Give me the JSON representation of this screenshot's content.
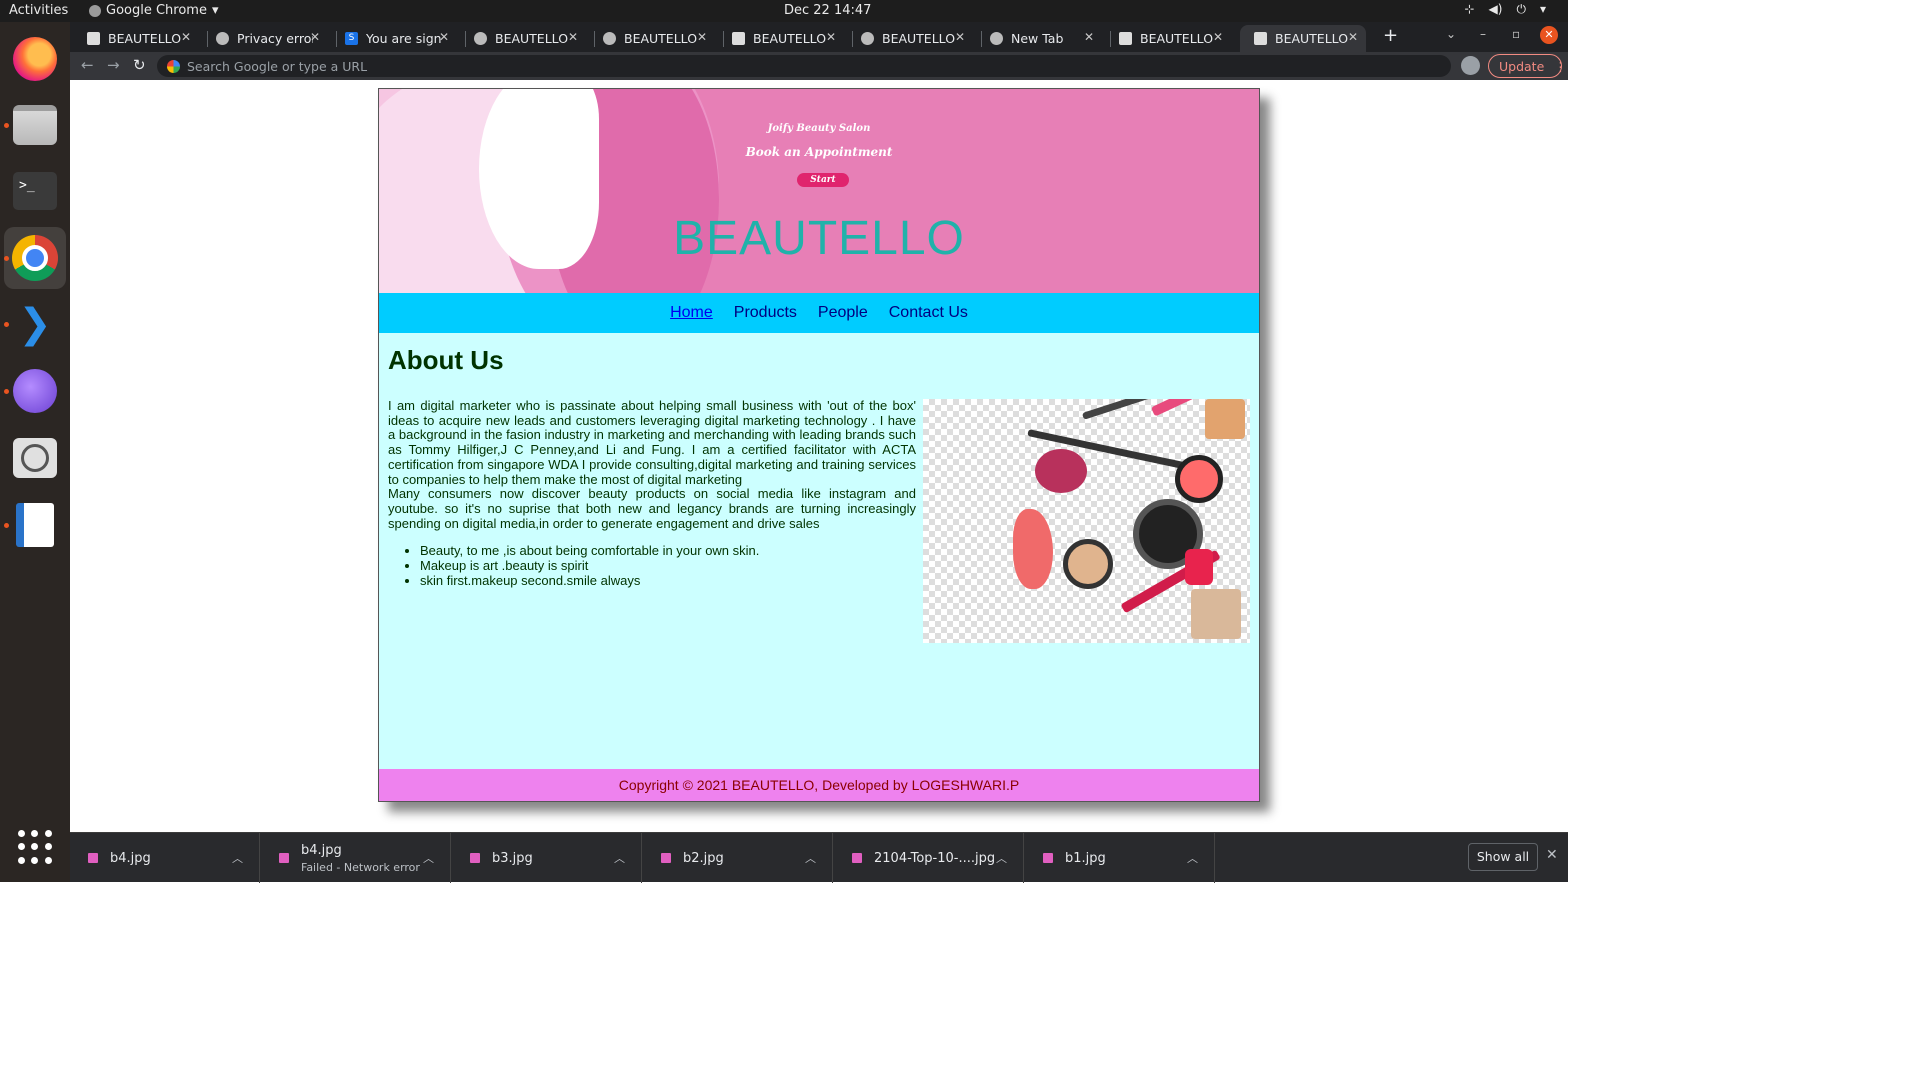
{
  "topbar": {
    "activities": "Activities",
    "app_name": "Google Chrome",
    "clock": "Dec 22  14:47"
  },
  "dock": {
    "items": [
      "firefox-icon",
      "files-icon",
      "terminal-icon",
      "chrome-icon",
      "vscode-icon",
      "browser-icon",
      "image-viewer-icon",
      "writer-icon"
    ]
  },
  "browser": {
    "tabs": [
      {
        "label": "BEAUTELLO"
      },
      {
        "label": "Privacy error"
      },
      {
        "label": "You are signed"
      },
      {
        "label": "BEAUTELLO"
      },
      {
        "label": "BEAUTELLO"
      },
      {
        "label": "BEAUTELLO"
      },
      {
        "label": "BEAUTELLO"
      },
      {
        "label": "New Tab"
      },
      {
        "label": "BEAUTELLO"
      },
      {
        "label": "BEAUTELLO"
      }
    ],
    "omnibox_placeholder": "Search Google or type a URL",
    "update_label": "Update"
  },
  "site": {
    "salon": "Joify Beauty Salon",
    "book": "Book an Appointment",
    "start": "Start",
    "brand": "BEAUTELLO",
    "nav": [
      "Home",
      "Products",
      "People",
      "Contact Us"
    ],
    "heading": "About Us",
    "para1": "I am digital marketer who is passinate about helping small business with 'out of the box' ideas to acquire new leads and customers leveraging digital marketing technology . I have a background in the fasion industry in marketing and merchanding with leading brands such as Tommy Hilfiger,J C Penney,and Li and Fung. I am a certified facilitator with ACTA certification from singapore WDA I provide consulting,digital marketing and training services to companies to help them make the most of digital marketing",
    "para2": "Many consumers now discover beauty products on social media like instagram and youtube. so it's no suprise that both new and legancy brands are turning increasingly spending on digital media,in order to generate engagement and drive sales",
    "bullets": [
      "Beauty, to me ,is about being comfortable in your own skin.",
      "Makeup is art .beauty is spirit",
      "skin first.makeup second.smile always"
    ],
    "footer": "Copyright © 2021 BEAUTELLO, Developed by LOGESHWARI.P"
  },
  "downloads": {
    "items": [
      {
        "name": "b4.jpg",
        "status": ""
      },
      {
        "name": "b4.jpg",
        "status": "Failed - Network error"
      },
      {
        "name": "b3.jpg",
        "status": ""
      },
      {
        "name": "b2.jpg",
        "status": ""
      },
      {
        "name": "2104-Top-10-....jpg",
        "status": ""
      },
      {
        "name": "b1.jpg",
        "status": ""
      }
    ],
    "show_all": "Show all"
  }
}
